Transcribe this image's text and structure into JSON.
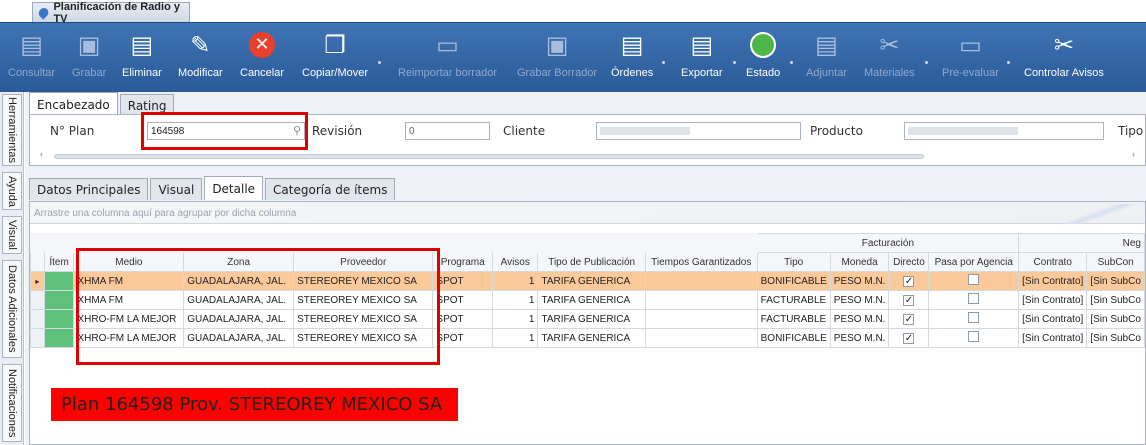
{
  "window": {
    "title": "Planificación de Radio y TV"
  },
  "toolbar": {
    "buttons": [
      {
        "label": "Consultar",
        "icon": "consult-icon",
        "enabled": false
      },
      {
        "label": "Grabar",
        "icon": "save-icon",
        "enabled": false
      },
      {
        "label": "Eliminar",
        "icon": "delete-icon",
        "enabled": true
      },
      {
        "label": "Modificar",
        "icon": "edit-icon",
        "enabled": true
      },
      {
        "label": "Cancelar",
        "icon": "cancel-icon",
        "enabled": true
      },
      {
        "label": "Copiar/Mover",
        "icon": "copy-icon",
        "enabled": true
      },
      {
        "label": "Reimportar borrador",
        "icon": "folder-icon",
        "enabled": false
      },
      {
        "label": "Grabar Borrador",
        "icon": "save-draft-icon",
        "enabled": false
      },
      {
        "label": "Órdenes",
        "icon": "orders-icon",
        "enabled": true
      },
      {
        "label": "Exportar",
        "icon": "export-icon",
        "enabled": true
      },
      {
        "label": "Estado",
        "icon": "status-icon",
        "enabled": true
      },
      {
        "label": "Adjuntar",
        "icon": "attach-icon",
        "enabled": false
      },
      {
        "label": "Materiales",
        "icon": "tools-icon",
        "enabled": false
      },
      {
        "label": "Pre-evaluar",
        "icon": "chart-icon",
        "enabled": false
      },
      {
        "label": "Controlar Avisos",
        "icon": "control-icon",
        "enabled": true
      }
    ]
  },
  "sidebar": {
    "tabs": [
      "Herramientas",
      "Ayuda",
      "Visual",
      "Datos Adicionales",
      "Notificaciones"
    ]
  },
  "header_tabs": [
    "Encabezado",
    "Rating"
  ],
  "header": {
    "plan_label": "N° Plan",
    "plan_value": "164598",
    "revision_label": "Revisión",
    "revision_value": "0",
    "cliente_label": "Cliente",
    "producto_label": "Producto",
    "tipo_label": "Tipo"
  },
  "detail_tabs": [
    "Datos Principales",
    "Visual",
    "Detalle",
    "Categoría de ítems"
  ],
  "grid": {
    "group_hint": "Arrastre una columna aquí para agrupar por dicha columna",
    "band_facturacion": "Facturación",
    "band_neg": "Neg",
    "columns": [
      "Ítem",
      "Medio",
      "Zona",
      "Proveedor",
      "Programa",
      "Avisos",
      "Tipo de Publicación",
      "Tiempos Garantizados",
      "Tipo",
      "Moneda",
      "Directo",
      "Pasa por Agencia",
      "Contrato",
      "SubCon"
    ],
    "rows": [
      {
        "item": "",
        "medio": "XHMA FM",
        "zona": "GUADALAJARA, JAL.",
        "proveedor": "STEREOREY MEXICO SA",
        "programa": "SPOT",
        "avisos": "1",
        "tipo_pub": "TARIFA GENERICA",
        "tiempos": "",
        "tipo": "BONIFICABLE",
        "moneda": "PESO M.N.",
        "directo": "✓",
        "agencia": "",
        "contrato": "[Sin Contrato]",
        "subcon": "[Sin SubCo"
      },
      {
        "item": "",
        "medio": "XHMA FM",
        "zona": "GUADALAJARA, JAL.",
        "proveedor": "STEREOREY MEXICO SA",
        "programa": "SPOT",
        "avisos": "1",
        "tipo_pub": "TARIFA GENERICA",
        "tiempos": "",
        "tipo": "FACTURABLE",
        "moneda": "PESO M.N.",
        "directo": "✓",
        "agencia": "",
        "contrato": "[Sin Contrato]",
        "subcon": "[Sin SubCo"
      },
      {
        "item": "",
        "medio": "XHRO-FM LA MEJOR",
        "zona": "GUADALAJARA, JAL.",
        "proveedor": "STEREOREY MEXICO SA",
        "programa": "SPOT",
        "avisos": "1",
        "tipo_pub": "TARIFA GENERICA",
        "tiempos": "",
        "tipo": "FACTURABLE",
        "moneda": "PESO M.N.",
        "directo": "✓",
        "agencia": "",
        "contrato": "[Sin Contrato]",
        "subcon": "[Sin SubCo"
      },
      {
        "item": "",
        "medio": "XHRO-FM LA MEJOR",
        "zona": "GUADALAJARA, JAL.",
        "proveedor": "STEREOREY MEXICO SA",
        "programa": "SPOT",
        "avisos": "1",
        "tipo_pub": "TARIFA GENERICA",
        "tiempos": "",
        "tipo": "BONIFICABLE",
        "moneda": "PESO M.N.",
        "directo": "✓",
        "agencia": "",
        "contrato": "[Sin Contrato]",
        "subcon": "[Sin SubCo"
      }
    ]
  },
  "annotation": {
    "caption": "Plan 164598 Prov. STEREOREY MEXICO SA",
    "color": "#ff0000"
  }
}
